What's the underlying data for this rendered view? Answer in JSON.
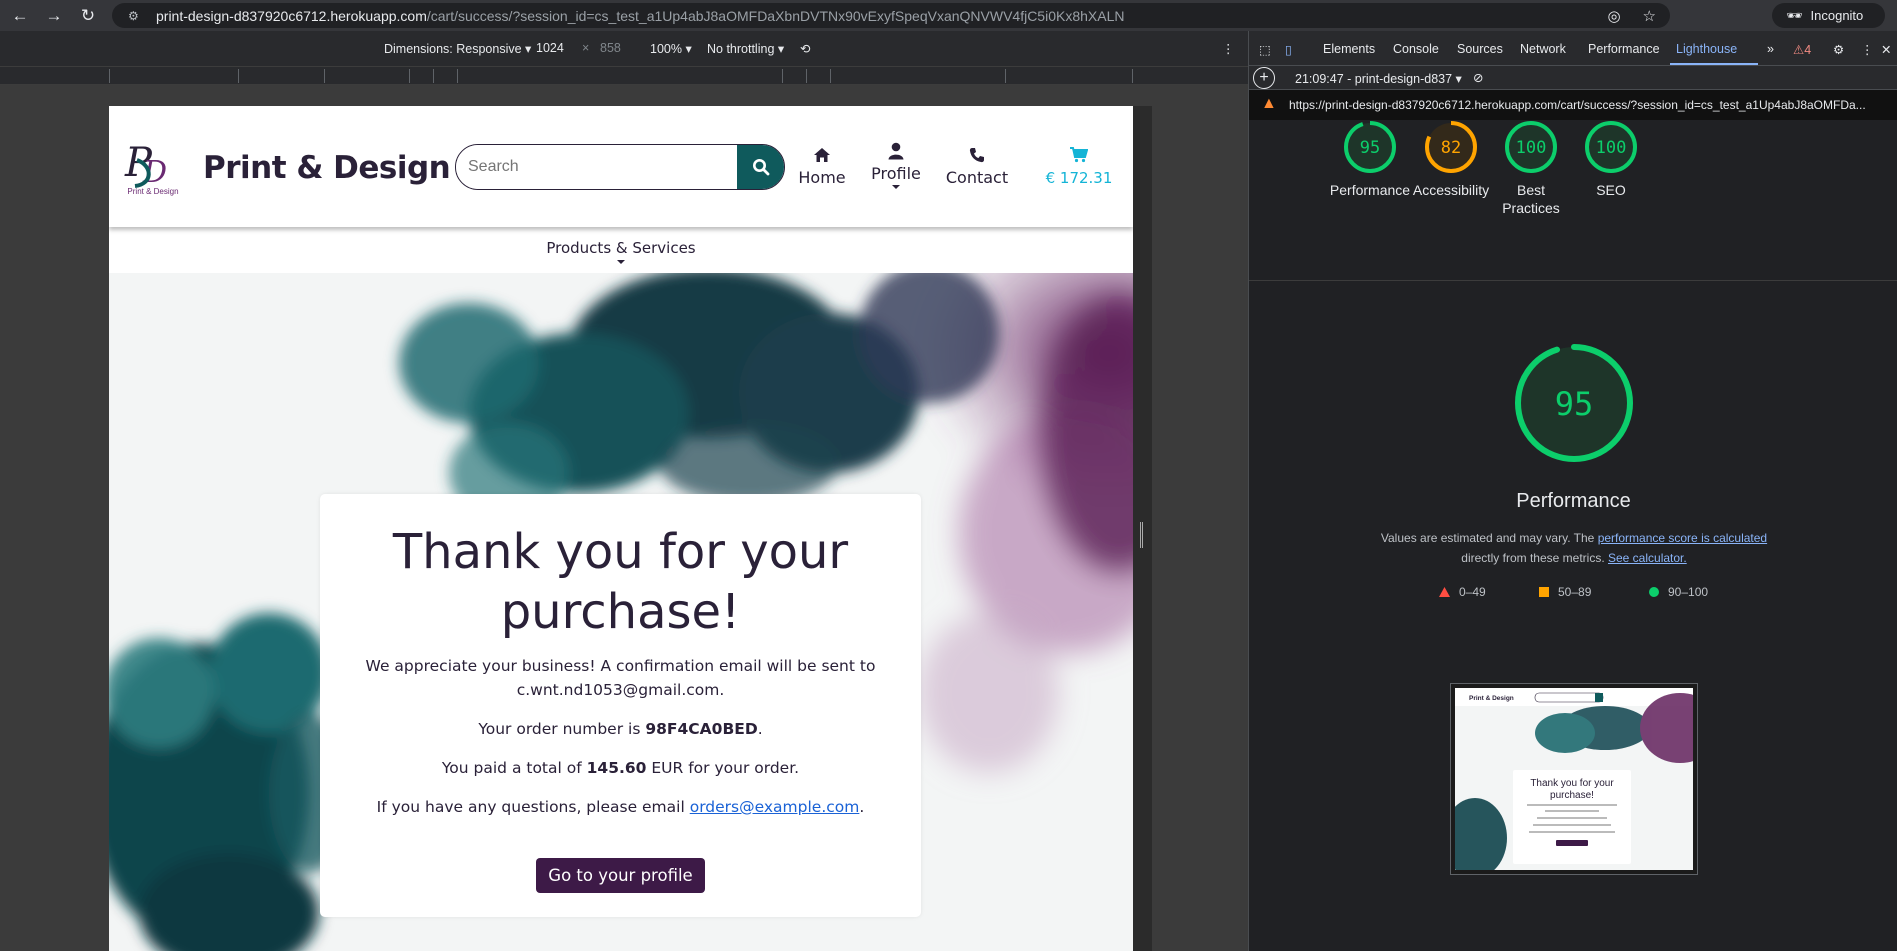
{
  "browser": {
    "url_main": "print-design-d837920c6712.herokuapp.com",
    "url_rest": "/cart/success/?session_id=cs_test_a1Up4abJ8aOMFDaXbnDVTNx90vExyfSpeqVxanQNVWV4fjC5i0Kx8hXALN",
    "incognito_label": "Incognito"
  },
  "device_toolbar": {
    "dimensions_label": "Dimensions: Responsive",
    "width": "1024",
    "height": "858",
    "zoom": "100%",
    "throttling": "No throttling"
  },
  "site": {
    "logo_text": "Print & Design",
    "brand": "Print & Design",
    "search_placeholder": "Search",
    "nav": {
      "home": "Home",
      "profile": "Profile",
      "contact": "Contact",
      "cart_total": "€ 172.31"
    },
    "subnav": "Products & Services"
  },
  "success": {
    "title": "Thank you for your purchase!",
    "appreciate": "We appreciate your business! A confirmation email will be sent to",
    "email": "c.wnt.nd1053@gmail.com.",
    "order_prefix": "Your order number is",
    "order_number": "98F4CA0BED",
    "order_suffix": ".",
    "paid_prefix": "You paid a total of",
    "paid_amount": "145.60",
    "paid_suffix": "EUR for your order.",
    "questions_prefix": "If you have any questions, please email",
    "questions_email": "orders@example.com",
    "questions_suffix": ".",
    "profile_button": "Go to your profile"
  },
  "devtools": {
    "tabs": [
      "Elements",
      "Console",
      "Sources",
      "Network",
      "Performance",
      "Lighthouse"
    ],
    "active_tab": "Lighthouse",
    "issues_count": "4",
    "report_time": "21:09:47 - print-design-d837",
    "report_url": "https://print-design-d837920c6712.herokuapp.com/cart/success/?session_id=cs_test_a1Up4abJ8aOMFDa...",
    "scores": [
      {
        "label": "Performance",
        "value": 95,
        "color": "#0cce6b"
      },
      {
        "label": "Accessibility",
        "value": 82,
        "color": "#ffa400"
      },
      {
        "label": "Best Practices",
        "value": 100,
        "color": "#0cce6b"
      },
      {
        "label": "SEO",
        "value": 100,
        "color": "#0cce6b"
      }
    ],
    "main_score": 95,
    "main_title": "Performance",
    "note_text": "Values are estimated and may vary. The",
    "note_link1": "performance score is calculated",
    "note_text2": "directly from these metrics.",
    "note_link2": "See calculator.",
    "legend": {
      "fail": "0–49",
      "average": "50–89",
      "pass": "90–100"
    },
    "colors": {
      "pass": "#0cce6b",
      "average": "#ffa400",
      "fail": "#ff4e42"
    }
  },
  "thumbnail": {
    "brand": "Print & Design",
    "title": "Thank you for your purchase!"
  }
}
